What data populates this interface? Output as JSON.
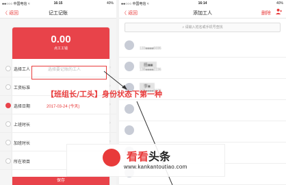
{
  "left": {
    "status": {
      "carrier": "●●○○○ 中国电信 ≈",
      "time": "16:15",
      "battery": "40%"
    },
    "nav": {
      "back": "〈 返回",
      "title": "记工记账"
    },
    "hero": {
      "amount": "0.00",
      "sub": "点工工钱"
    },
    "rows": [
      {
        "label": "选择工人",
        "value": "选择要记账的工人",
        "style": "placeholder"
      },
      {
        "label": "工资标准",
        "value": "",
        "style": "placeholder"
      },
      {
        "label": "选择日期",
        "value": "2017-03-24 (今天)",
        "style": "value"
      },
      {
        "label": "上班时长",
        "value": "",
        "style": "value"
      },
      {
        "label": "加班时长",
        "value": "",
        "style": "value"
      },
      {
        "label": "所在项目",
        "value": "",
        "style": "value"
      }
    ],
    "save": "保存"
  },
  "right": {
    "status": {
      "carrier": "●●○○○ 中国电信 ≈",
      "time": "16:14",
      "battery": "40%"
    },
    "nav": {
      "back": "〈 返回",
      "title": "添加工人",
      "delete": "删除",
      "add_icon": "add-user-icon"
    },
    "search_placeholder": "请输入姓名或手机号查找",
    "workers": [
      {
        "name": "",
        "phone": "133■■■■6696"
      },
      {
        "name": "杨■■",
        "phone": "138■■■■2236"
      },
      {
        "name": "李■",
        "phone": "139■■■■6676"
      },
      {
        "name": "",
        "phone": ""
      },
      {
        "name": "",
        "phone": ""
      },
      {
        "name": "",
        "phone": ""
      },
      {
        "name": "",
        "phone": ""
      }
    ]
  },
  "caption": "【班组长/工头】身份状态下第一种",
  "watermark": {
    "brand_red": "看看",
    "brand_black": "头条",
    "url": "www.kankantoutiao.com"
  },
  "colors": {
    "accent": "#e83a3a"
  }
}
